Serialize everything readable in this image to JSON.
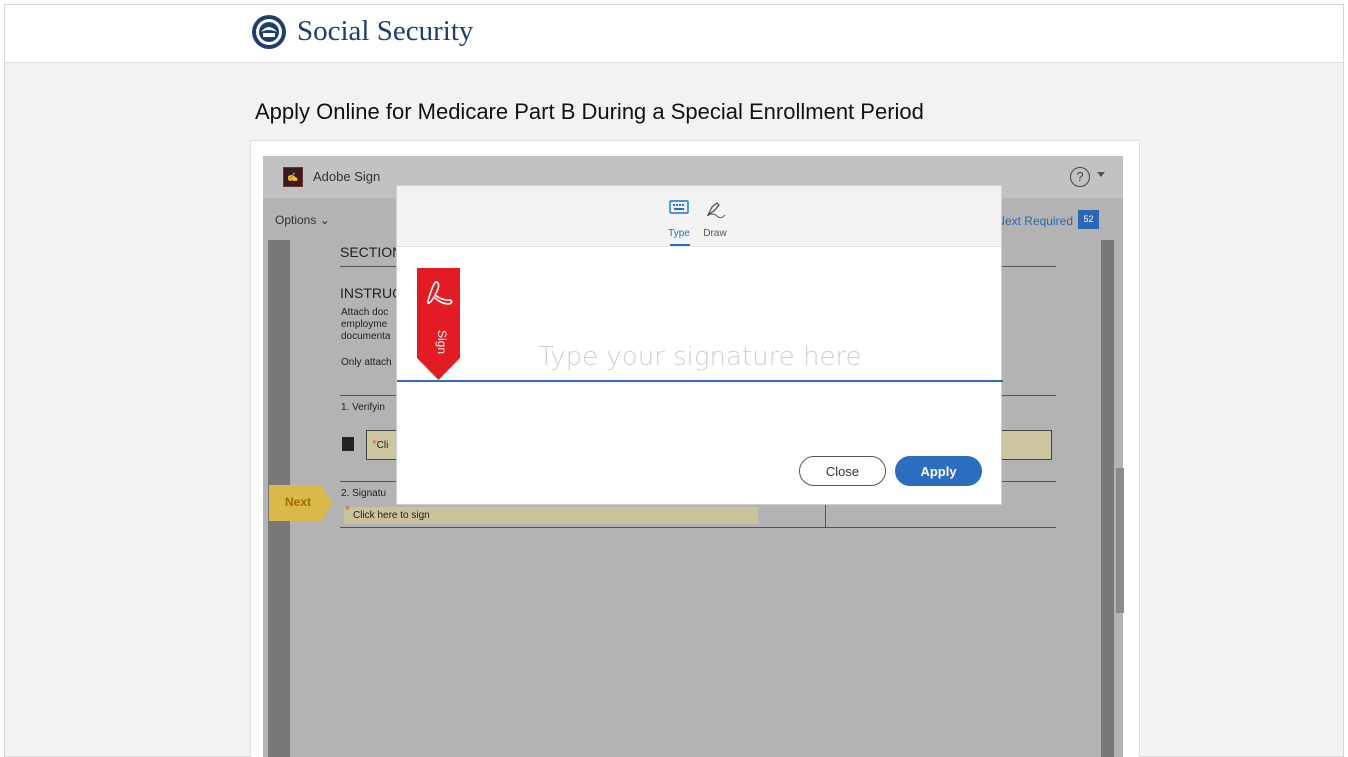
{
  "header": {
    "brand": "Social Security"
  },
  "page": {
    "title": "Apply Online for Medicare Part B During a Special Enrollment Period"
  },
  "adobe": {
    "app_title": "Adobe Sign",
    "help_label": "?",
    "options_label": "Options ⌄",
    "next_required_label": "Next Required",
    "next_required_count": "52"
  },
  "document": {
    "section_heading": "SECTION",
    "instructions_heading": "INSTRUC",
    "attach_line1": "Attach doc",
    "attach_line2": "employme",
    "attach_line3": "documenta",
    "only_attach": "Only attach",
    "item1": "1. Verifyin",
    "item1_field": "Cli",
    "item2": "2. Signatu",
    "sign_field": "Click here to sign",
    "next_tag": "Next",
    "required_mark": "*"
  },
  "modal": {
    "tabs": [
      {
        "label": "Type",
        "icon": "keyboard-icon",
        "active": true
      },
      {
        "label": "Draw",
        "icon": "pen-icon",
        "active": false
      }
    ],
    "signature_placeholder": "Type your signature here",
    "signature_value": "",
    "ribbon_label": "Sign",
    "close_label": "Close",
    "apply_label": "Apply"
  },
  "colors": {
    "brand_navy": "#1f3d6e",
    "accent_blue": "#2b6dbf",
    "adobe_red": "#e31b23",
    "next_tag_yellow": "#d8b94a"
  }
}
